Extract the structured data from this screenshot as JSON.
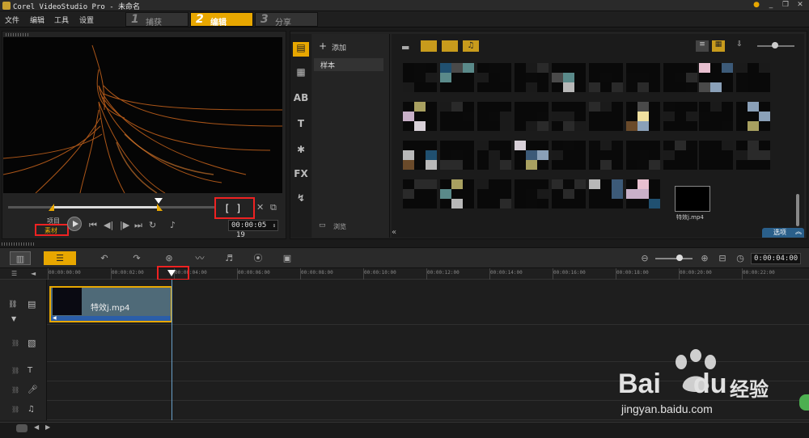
{
  "window": {
    "title": "Corel VideoStudio Pro - 未命名"
  },
  "menu": {
    "items": [
      "文件",
      "编辑",
      "工具",
      "设置"
    ]
  },
  "steps": [
    {
      "num": "1",
      "label": "捕获",
      "active": false
    },
    {
      "num": "2",
      "label": "编辑",
      "active": true
    },
    {
      "num": "3",
      "label": "分享",
      "active": false
    }
  ],
  "preview": {
    "mode_project": "项目",
    "mode_clip": "素材",
    "timecode": "00:00:05",
    "timecode_frames": "19",
    "trim_brackets": "[  ]",
    "scrub_position": 0.73
  },
  "library": {
    "add_label": "添加",
    "folder": "样本",
    "browse_label": "浏览",
    "options_label": "选项",
    "selected_item_label": "特效j.mp4"
  },
  "timeline": {
    "zoom_time": "0:00:04:00",
    "ruler_ticks": [
      "00:00:00:00",
      "00:00:02:00",
      "00:00:04:00",
      "00:00:06:00",
      "00:00:08:00",
      "00:00:10:00",
      "00:00:12:00",
      "00:00:14:00",
      "00:00:16:00",
      "00:00:18:00",
      "00:00:20:00",
      "00:00:22:00"
    ],
    "clip_label": "特效j.mp4"
  },
  "watermark": {
    "brand": "Bai",
    "brand2": "du",
    "brand3": "经验",
    "url": "jingyan.baidu.com"
  },
  "colors": {
    "accent": "#e8a700",
    "highlight": "#e22222",
    "playline": "#6aa0c8"
  }
}
